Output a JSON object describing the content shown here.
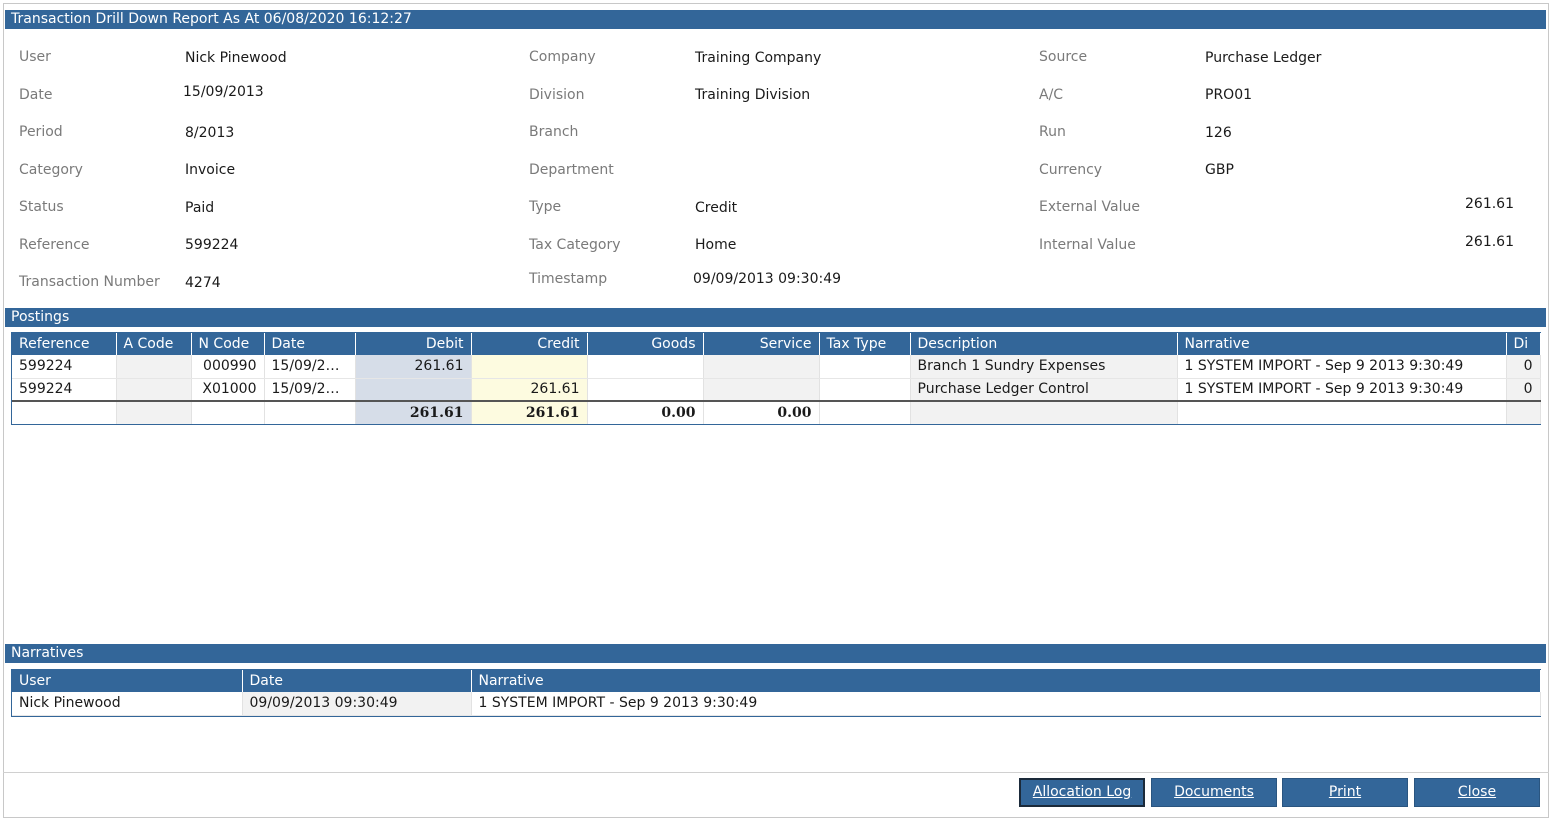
{
  "title_bar": "Transaction Drill Down Report As At 06/08/2020 16:12:27",
  "info": {
    "col1": [
      {
        "label": "User",
        "value": "Nick Pinewood"
      },
      {
        "label": "Date",
        "value": "15/09/2013"
      },
      {
        "label": "Period",
        "value": "8/2013"
      },
      {
        "label": "Category",
        "value": "Invoice"
      },
      {
        "label": "Status",
        "value": "Paid"
      },
      {
        "label": "Reference",
        "value": "599224"
      },
      {
        "label": "Transaction Number",
        "value": "4274"
      }
    ],
    "col2": [
      {
        "label": "Company",
        "value": "Training Company"
      },
      {
        "label": "Division",
        "value": "Training Division"
      },
      {
        "label": "Branch",
        "value": ""
      },
      {
        "label": "Department",
        "value": ""
      },
      {
        "label": "Type",
        "value": "Credit"
      },
      {
        "label": "Tax Category",
        "value": "Home"
      },
      {
        "label": "Timestamp",
        "value": "09/09/2013 09:30:49"
      }
    ],
    "col3": [
      {
        "label": "Source",
        "value": "Purchase Ledger"
      },
      {
        "label": "A/C",
        "value": "PRO01"
      },
      {
        "label": "Run",
        "value": "126"
      },
      {
        "label": "Currency",
        "value": "GBP"
      },
      {
        "label": "External Value",
        "value": "261.61"
      },
      {
        "label": "Internal Value",
        "value": "261.61"
      }
    ]
  },
  "postings": {
    "section_title": "Postings",
    "headers": [
      "Reference",
      "A Code",
      "N Code",
      "Date",
      "Debit",
      "Credit",
      "Goods",
      "Service",
      "Tax Type",
      "Description",
      "Narrative",
      "Di"
    ],
    "rows": [
      [
        "599224",
        "",
        "000990",
        "15/09/20...",
        "261.61",
        "",
        "",
        "",
        "",
        "Branch 1 Sundry Expenses",
        "1 SYSTEM IMPORT - Sep 9 2013 9:30:49",
        "0"
      ],
      [
        "599224",
        "",
        "X01000",
        "15/09/20...",
        "",
        "261.61",
        "",
        "",
        "",
        "Purchase Ledger Control",
        "1 SYSTEM IMPORT - Sep 9 2013 9:30:49",
        "0"
      ]
    ],
    "totals": {
      "debit": "261.61",
      "credit": "261.61",
      "goods": "0.00",
      "service": "0.00"
    }
  },
  "narratives": {
    "section_title": "Narratives",
    "headers": [
      "User",
      "Date",
      "Narrative"
    ],
    "rows": [
      [
        "Nick Pinewood",
        "09/09/2013 09:30:49",
        "1 SYSTEM IMPORT - Sep 9 2013 9:30:49"
      ]
    ]
  },
  "buttons": {
    "allocation_log": "Allocation Log",
    "documents": "Documents",
    "print": "Print",
    "close": "Close"
  },
  "colors": {
    "header_blue": "#336699",
    "debit_shade": "#d6dde8",
    "credit_shade": "#fdfbe0"
  }
}
